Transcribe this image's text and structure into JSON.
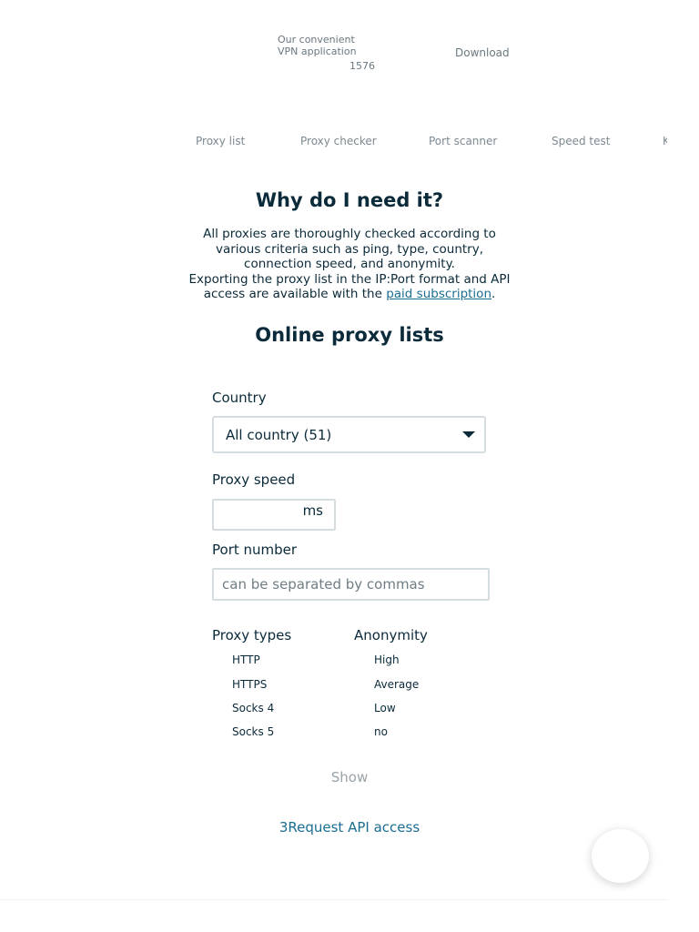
{
  "promo": {
    "text": "Our convenient VPN application",
    "count": "1576",
    "download_label": "Download"
  },
  "nav": {
    "items": [
      {
        "label": "Proxy list"
      },
      {
        "label": "Proxy checker"
      },
      {
        "label": "Port scanner"
      },
      {
        "label": "Speed test"
      },
      {
        "label": "K"
      }
    ]
  },
  "why": {
    "title": "Why do I need it?",
    "text1": "All proxies are thoroughly checked according to various criteria such as ping, type, country, connection speed, and anonymity.",
    "text2": "Exporting the proxy list in the IP:Port format and API access are available with the ",
    "link": "paid subscription",
    "text_end": "."
  },
  "lists": {
    "title": "Online proxy lists"
  },
  "filters": {
    "country_label": "Country",
    "country_value": "All country (51)",
    "speed_label": "Proxy speed",
    "speed_unit": "ms",
    "port_label": "Port number",
    "port_placeholder": "can be separated by commas",
    "types_label": "Proxy types",
    "types": [
      "HTTP",
      "HTTPS",
      "Socks 4",
      "Socks 5"
    ],
    "anonymity_label": "Anonymity",
    "anonymity": [
      "High",
      "Average",
      "Low",
      "no"
    ]
  },
  "actions": {
    "show_label": "Show",
    "api_label": "3Request API access"
  },
  "colors": {
    "text": "#0b2a3a",
    "link": "#1a6e91",
    "muted": "#7d8a91",
    "border": "#d6dde1"
  }
}
